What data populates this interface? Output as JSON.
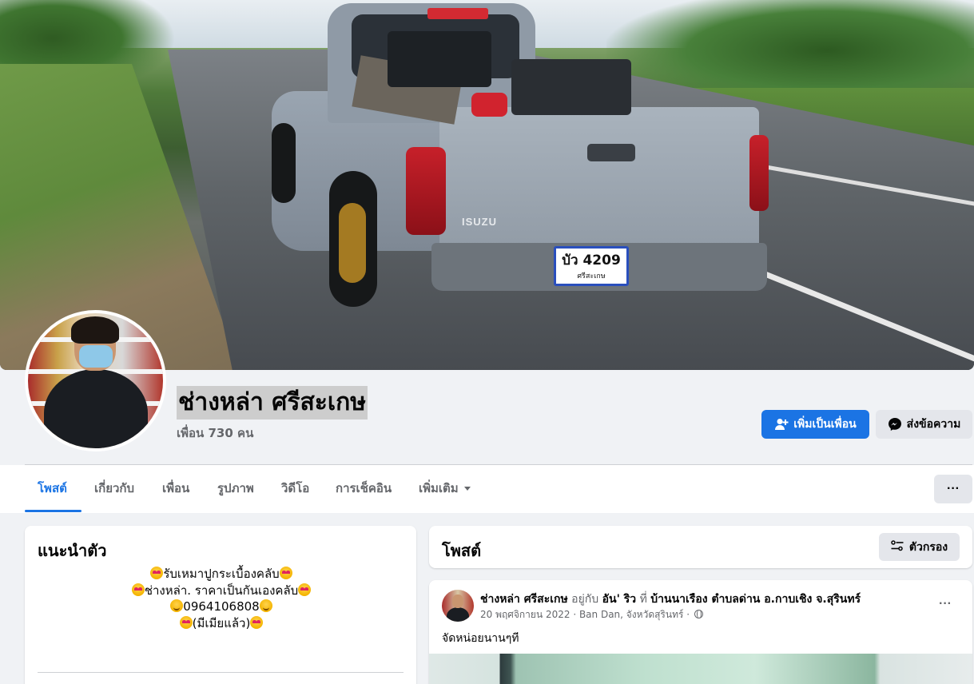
{
  "profile": {
    "name": "ช่างหล่า ศรีสะเกษ",
    "friends": "เพื่อน 730 คน",
    "plate_main": "บัว 4209",
    "plate_sub": "ศรีสะเกษ",
    "truck_brand": "ISUZU"
  },
  "actions": {
    "add_friend": "เพิ่มเป็นเพื่อน",
    "message": "ส่งข้อความ",
    "more": "···"
  },
  "tabs": [
    {
      "label": "โพสต์",
      "active": true
    },
    {
      "label": "เกี่ยวกับ"
    },
    {
      "label": "เพื่อน"
    },
    {
      "label": "รูปภาพ"
    },
    {
      "label": "วิดีโอ"
    },
    {
      "label": "การเช็คอิน"
    },
    {
      "label": "เพิ่มเติม"
    }
  ],
  "intro": {
    "title": "แนะนำตัว",
    "bio_lines": [
      "รับเหมาปูกระเบื้องคลับ",
      "ช่างหล่า. ราคาเป็นกันเองคลับ",
      "0964106808",
      "(มีเมียแล้ว)"
    ]
  },
  "posts": {
    "title": "โพสต์",
    "filter_label": "ตัวกรอง",
    "items": [
      {
        "author": "ช่างหล่า ศรีสะเกษ",
        "with_prefix": "อยู่กับ",
        "with_name": "อัน' ริว",
        "at_prefix": "ที่",
        "place": "บ้านนาเรือง ตำบลด่าน อ.กาบเชิง จ.สุรินทร์",
        "date": "20 พฤศจิกายน 2022 · Ban Dan, จังหวัดสุรินทร์ ·",
        "text": "จัดหน่อยนานๆที",
        "menu": "···"
      }
    ]
  },
  "colors": {
    "accent": "#1b74e4",
    "page_bg": "#f0f2f5",
    "secondary_button": "#e4e6eb"
  },
  "icons": [
    "add-friend-icon",
    "messenger-icon",
    "filter-icon",
    "globe-icon",
    "caret-down-icon",
    "more-dots-icon"
  ]
}
